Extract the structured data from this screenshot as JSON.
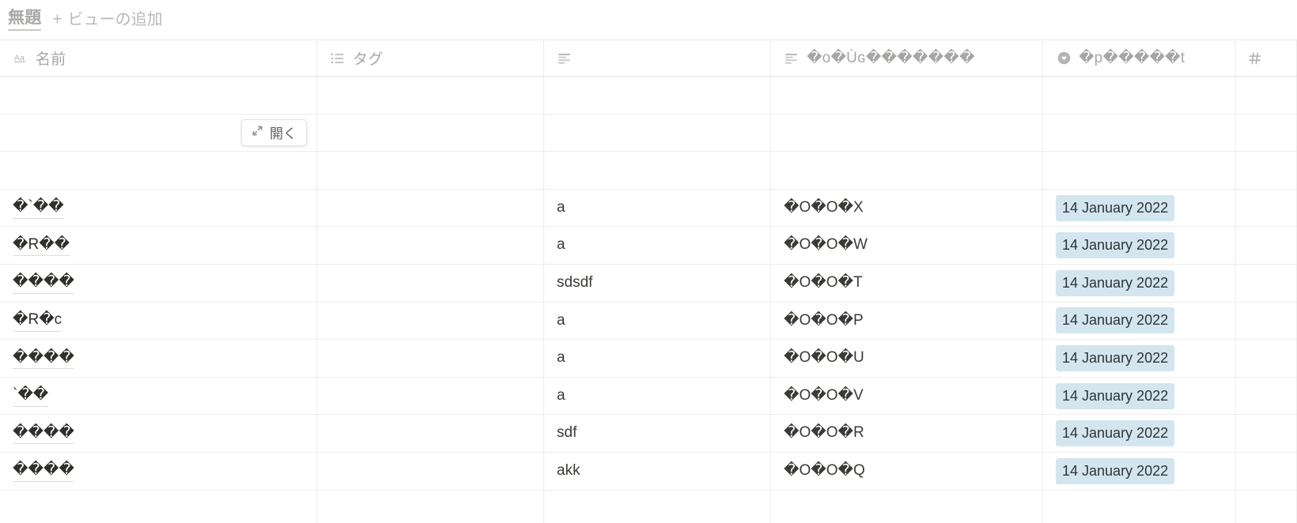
{
  "view_bar": {
    "current_view": "無題",
    "add_view_label": "ビューの追加",
    "add_view_icon": "plus-icon"
  },
  "hover_row": {
    "open_button_label": "開く",
    "open_button_icon": "expand-arrows-icon"
  },
  "table": {
    "columns": [
      {
        "label": "名前",
        "icon": "title-text-icon",
        "type": "title"
      },
      {
        "label": "タグ",
        "icon": "multi-select-icon",
        "type": "multi_select"
      },
      {
        "label": "",
        "icon": "text-lines-icon",
        "type": "text"
      },
      {
        "label": "�o�Ùɢ�������",
        "icon": "text-lines-icon",
        "type": "text"
      },
      {
        "label": "�p�����t",
        "icon": "select-circle-icon",
        "type": "select"
      },
      {
        "label": "",
        "icon": "number-hash-icon",
        "type": "number"
      }
    ],
    "empty_rows": [
      {
        "name": "",
        "tags": "",
        "text": "",
        "text2": "",
        "date": "",
        "num": ""
      },
      {
        "name": "",
        "tags": "",
        "text": "",
        "text2": "",
        "date": "",
        "num": ""
      },
      {
        "name": "",
        "tags": "",
        "text": "",
        "text2": "",
        "date": "",
        "num": ""
      }
    ],
    "rows": [
      {
        "name": "�`��",
        "tags": "",
        "text": "a",
        "text2": "�O�O�X",
        "date": "14 January 2022",
        "num": ""
      },
      {
        "name": "�R��",
        "tags": "",
        "text": "a",
        "text2": "�O�O�W",
        "date": "14 January 2022",
        "num": ""
      },
      {
        "name": "����",
        "tags": "",
        "text": "sdsdf",
        "text2": "�O�O�T",
        "date": "14 January 2022",
        "num": ""
      },
      {
        "name": "�R�c",
        "tags": "",
        "text": "a",
        "text2": "�O�O�P",
        "date": "14 January 2022",
        "num": ""
      },
      {
        "name": "����",
        "tags": "",
        "text": "a",
        "text2": "�O�O�U",
        "date": "14 January 2022",
        "num": ""
      },
      {
        "name": "`��",
        "tags": "",
        "text": "a",
        "text2": "�O�O�V",
        "date": "14 January 2022",
        "num": ""
      },
      {
        "name": "����",
        "tags": "",
        "text": "sdf",
        "text2": "�O�O�R",
        "date": "14 January 2022",
        "num": ""
      },
      {
        "name": "����",
        "tags": "",
        "text": "akk",
        "text2": "�O�O�Q",
        "date": "14 January 2022",
        "num": ""
      }
    ]
  },
  "colors": {
    "date_pill_background": "#d3e5ef",
    "text_primary": "#2f2f2c",
    "text_muted": "#a6a6a4",
    "border": "#ededed"
  }
}
